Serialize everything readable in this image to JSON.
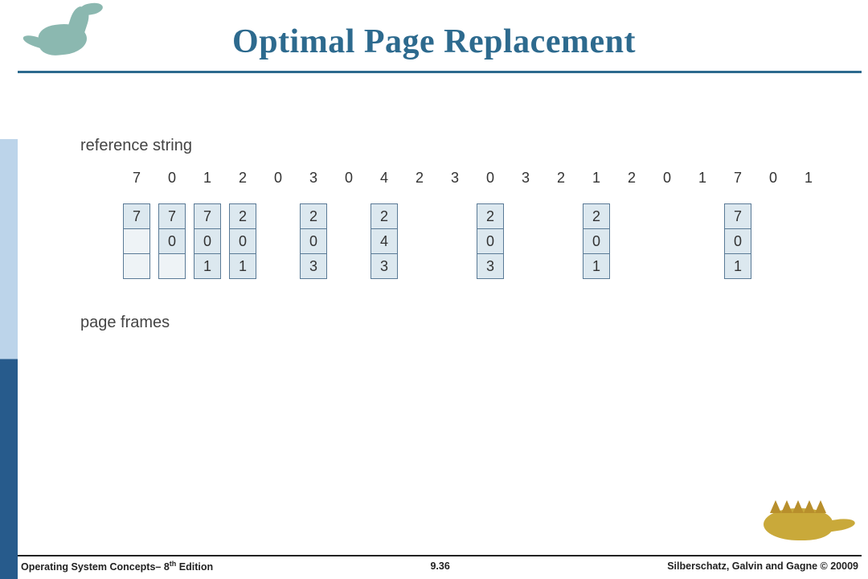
{
  "title": "Optimal Page Replacement",
  "labels": {
    "reference": "reference string",
    "frames": "page frames"
  },
  "reference_string": [
    "7",
    "0",
    "1",
    "2",
    "0",
    "3",
    "0",
    "4",
    "2",
    "3",
    "0",
    "3",
    "2",
    "1",
    "2",
    "0",
    "1",
    "7",
    "0",
    "1"
  ],
  "frames": [
    {
      "pos": 0,
      "cells": [
        "7",
        "",
        ""
      ]
    },
    {
      "pos": 1,
      "cells": [
        "7",
        "0",
        ""
      ]
    },
    {
      "pos": 2,
      "cells": [
        "7",
        "0",
        "1"
      ]
    },
    {
      "pos": 3,
      "cells": [
        "2",
        "0",
        "1"
      ]
    },
    {
      "pos": 5,
      "cells": [
        "2",
        "0",
        "3"
      ]
    },
    {
      "pos": 7,
      "cells": [
        "2",
        "4",
        "3"
      ]
    },
    {
      "pos": 10,
      "cells": [
        "2",
        "0",
        "3"
      ]
    },
    {
      "pos": 13,
      "cells": [
        "2",
        "0",
        "1"
      ]
    },
    {
      "pos": 17,
      "cells": [
        "7",
        "0",
        "1"
      ]
    }
  ],
  "footer": {
    "left_prefix": "Operating System Concepts– 8",
    "left_sup": "th",
    "left_suffix": " Edition",
    "mid": "9.36",
    "right": "Silberschatz, Galvin and Gagne © 20009"
  },
  "layout": {
    "ref_cell_width": 44,
    "frame_col_width": 34
  }
}
